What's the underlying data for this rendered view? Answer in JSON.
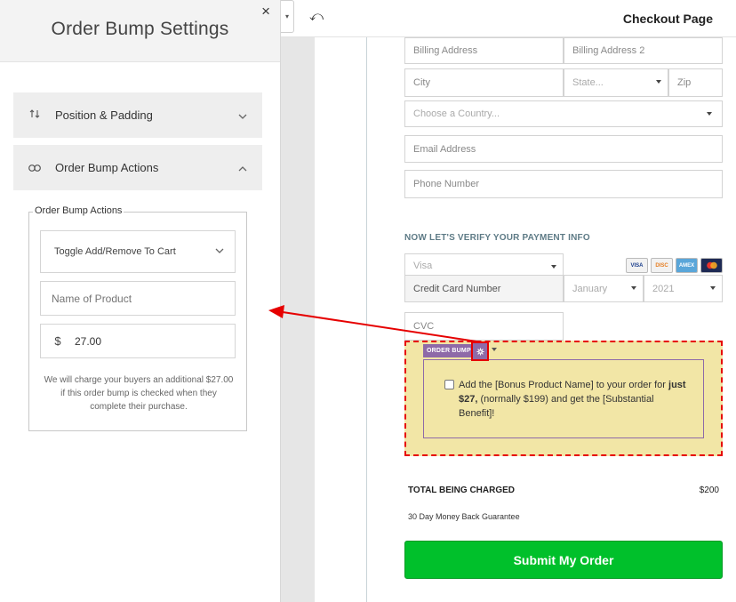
{
  "panel": {
    "title": "Order Bump Settings",
    "close": "×",
    "accordions": [
      {
        "label": "Position & Padding",
        "icon": "up-down-arrows-icon"
      },
      {
        "label": "Order Bump Actions",
        "icon": "link-icon"
      }
    ],
    "actions": {
      "legend": "Order Bump Actions",
      "select_value": "Toggle Add/Remove To Cart",
      "product_placeholder": "Name of Product",
      "currency": "$",
      "price": "27.00",
      "note": "We will charge your buyers an additional $27.00 if this order bump is checked when they complete their purchase."
    }
  },
  "topbar": {
    "page_title": "Checkout Page",
    "undo": "⤺"
  },
  "form": {
    "billing_address": "Billing Address",
    "billing_address_2": "Billing Address 2",
    "city": "City",
    "state": "State...",
    "zip": "Zip",
    "country": "Choose a Country...",
    "email": "Email Address",
    "phone": "Phone Number",
    "payment_heading": "NOW LET'S VERIFY YOUR PAYMENT INFO",
    "card_type": "Visa",
    "card_number": "Credit Card Number",
    "month": "January",
    "year": "2021",
    "cvc": "CVC",
    "card_logos": [
      "VISA",
      "DISC",
      "AMEX",
      "MC"
    ]
  },
  "bump": {
    "tag": "ORDER BUMP",
    "text_a": "Add the [Bonus Product Name] to your order for ",
    "text_bold": "just $27,",
    "text_b": " (normally $199) and get the [Substantial Benefit]!"
  },
  "summary": {
    "total_label": "TOTAL BEING CHARGED",
    "total_value": "$200",
    "guarantee": "30 Day Money Back Guarantee",
    "submit": "Submit My Order"
  },
  "colors": {
    "accent_red": "#e60000",
    "bump_bg": "#f2e6a6",
    "bump_purple": "#8e6aa8",
    "submit_green": "#00c02b"
  }
}
